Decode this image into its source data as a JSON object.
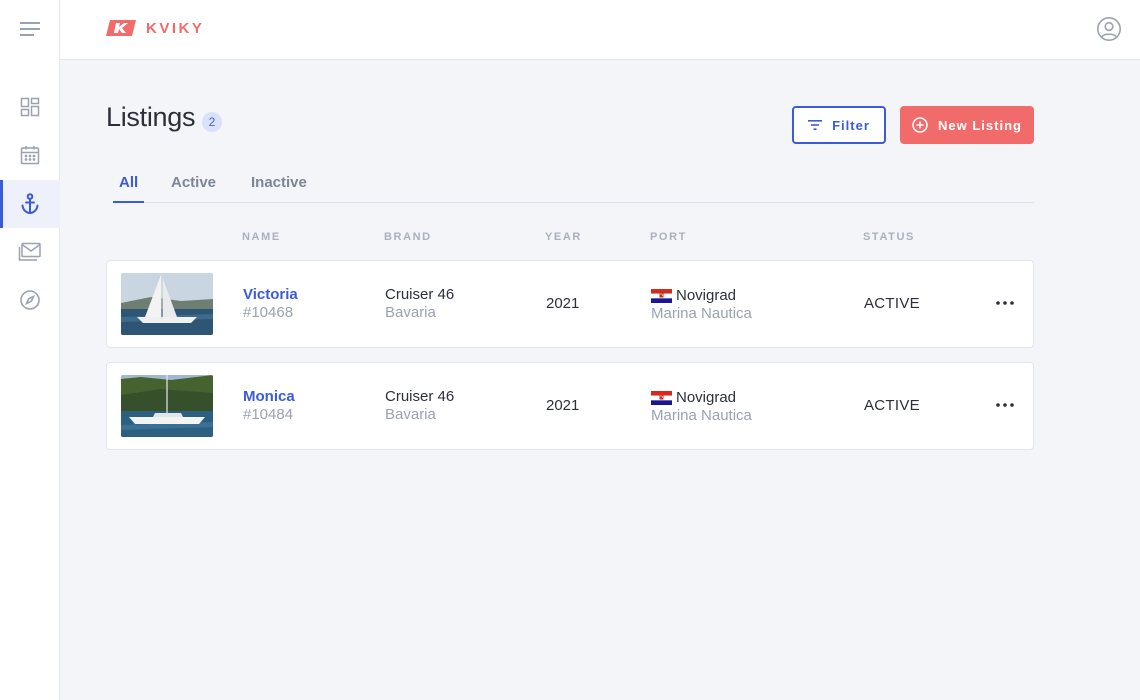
{
  "brand": {
    "name": "KVIKY",
    "color": "#f26b6b"
  },
  "sidebar": {
    "items": [
      {
        "icon": "dashboard-icon",
        "active": false
      },
      {
        "icon": "calendar-icon",
        "active": false
      },
      {
        "icon": "anchor-icon",
        "active": true
      },
      {
        "icon": "mail-icon",
        "active": false
      },
      {
        "icon": "compass-icon",
        "active": false
      }
    ]
  },
  "page": {
    "title": "Listings",
    "count": "2"
  },
  "actions": {
    "filter_label": "Filter",
    "new_label": "New Listing"
  },
  "tabs": [
    {
      "label": "All",
      "active": true
    },
    {
      "label": "Active",
      "active": false
    },
    {
      "label": "Inactive",
      "active": false
    }
  ],
  "columns": {
    "name": "NAME",
    "brand": "BRAND",
    "year": "YEAR",
    "port": "PORT",
    "status": "STATUS"
  },
  "listings": [
    {
      "name": "Victoria",
      "ref": "#10468",
      "model": "Cruiser 46",
      "make": "Bavaria",
      "year": "2021",
      "port": "Novigrad",
      "marina": "Marina Nautica",
      "status": "ACTIVE"
    },
    {
      "name": "Monica",
      "ref": "#10484",
      "model": "Cruiser 46",
      "make": "Bavaria",
      "year": "2021",
      "port": "Novigrad",
      "marina": "Marina Nautica",
      "status": "ACTIVE"
    }
  ],
  "colors": {
    "accent": "#3b5bdb",
    "primary_button": "#f26b6b",
    "background": "#f4f5f9"
  }
}
